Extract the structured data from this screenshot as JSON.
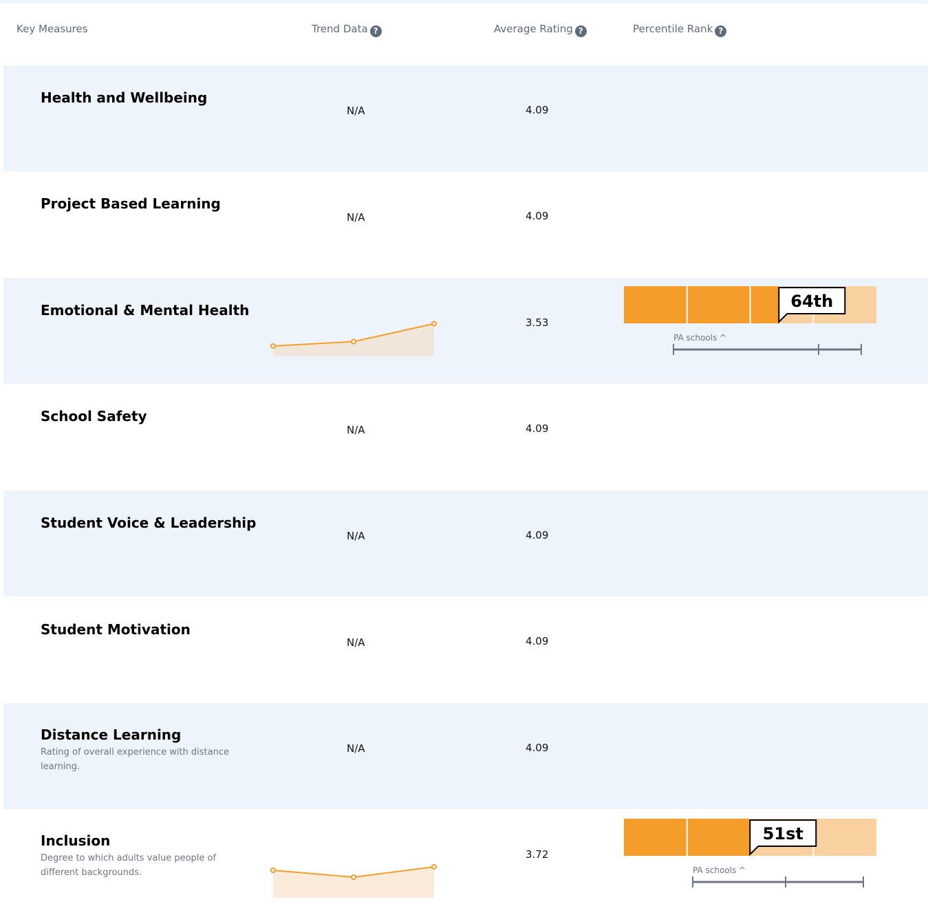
{
  "header": {
    "key_measures": "Key Measures",
    "trend_data": "Trend Data",
    "average_rating": "Average Rating",
    "percentile_rank": "Percentile Rank",
    "help_glyph": "?"
  },
  "rows": [
    {
      "title": "Health and Wellbeing",
      "trend": "N/A",
      "average": "4.09"
    },
    {
      "title": "Project Based Learning",
      "trend": "N/A",
      "average": "4.09"
    },
    {
      "title": "Emotional & Mental Health",
      "average": "3.53",
      "trend_points": [
        0.0,
        0.13,
        0.65
      ],
      "percentile": {
        "label": "64th",
        "value": 64,
        "group": "PA schools ^"
      }
    },
    {
      "title": "School Safety",
      "trend": "N/A",
      "average": "4.09"
    },
    {
      "title": "Student Voice & Leadership",
      "trend": "N/A",
      "average": "4.09"
    },
    {
      "title": "Student Motivation",
      "trend": "N/A",
      "average": "4.09"
    },
    {
      "title": "Distance Learning",
      "description": "Rating of overall experience with distance learning.",
      "trend": "N/A",
      "average": "4.09"
    },
    {
      "title": "Inclusion",
      "description": "Degree to which adults value people of different backgrounds.",
      "average": "3.72",
      "trend_points": [
        0.5,
        0.3,
        0.6
      ],
      "percentile": {
        "label": "51st",
        "value": 51,
        "group": "PA schools ^"
      }
    }
  ],
  "colors": {
    "accent": "#f59d2a",
    "bar_light": "#f9d09f",
    "row_shade": "#edf4fb",
    "bracket": "#6d7680"
  }
}
